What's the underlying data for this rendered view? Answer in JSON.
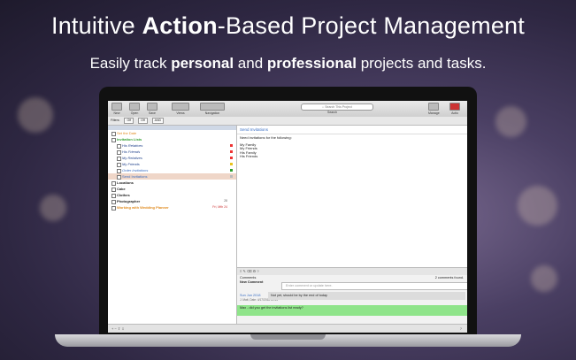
{
  "headline": {
    "part1": "Intuitive ",
    "bold": "Action",
    "part2": "-Based Project Management"
  },
  "subheadline": {
    "part1": "Easily track ",
    "bold1": "personal",
    "part2": " and ",
    "bold2": "professional",
    "part3": " projects and tasks."
  },
  "toolbar": {
    "new": "New",
    "open": "Open",
    "save": "Save",
    "views": "Views",
    "navigation": "Navigation",
    "search_placeholder": "Search This Project",
    "search_label": "Search",
    "manage": "Manage",
    "actio": "Actio"
  },
  "filters": {
    "label": "Filters:",
    "off1": "Off",
    "off2": "Off",
    "and": "AND"
  },
  "tasks": [
    {
      "label": "Set the Date",
      "color": "#e08a1e"
    },
    {
      "label": "Invitation Lists",
      "color": "#2e9e2e"
    },
    {
      "label": "His Relatives",
      "color": "#1d3f8a"
    },
    {
      "label": "His Friends",
      "color": "#1d3f8a"
    },
    {
      "label": "My Relatives",
      "color": "#1d3f8a"
    },
    {
      "label": "My Friends",
      "color": "#1d3f8a"
    },
    {
      "label": "Order Invitations",
      "color": "#3a6fc4"
    },
    {
      "label": "Send Invitations",
      "color": "#3a6fc4"
    },
    {
      "label": "Locations",
      "color": "#111111"
    },
    {
      "label": "Cake",
      "color": "#111111"
    },
    {
      "label": "Clothes",
      "color": "#111111"
    },
    {
      "label": "Photographer",
      "color": "#111111"
    },
    {
      "label": "Working with Wedding Planner",
      "color": "#e08a1e"
    }
  ],
  "task_meta": {
    "photographer": "28",
    "planner": "Fri, Mth 24"
  },
  "detail": {
    "title": "Send Invitations",
    "line1": "Need invitations for the following:",
    "items": [
      "My Family",
      "My Friends",
      "His Family",
      "His Friends"
    ]
  },
  "comments": {
    "title": "Comments",
    "count": "2 comments found.",
    "new_label": "New Comment",
    "input_placeholder": "Enter comment or update here.",
    "c1_date": "Sun Jun 2018",
    "c1_author": "J. Matt, Date: 4/17/2018 12:34",
    "c1_text": "Not yet, should be by the end of today",
    "c2_text": "Max - did you get the invitations list ready?"
  }
}
